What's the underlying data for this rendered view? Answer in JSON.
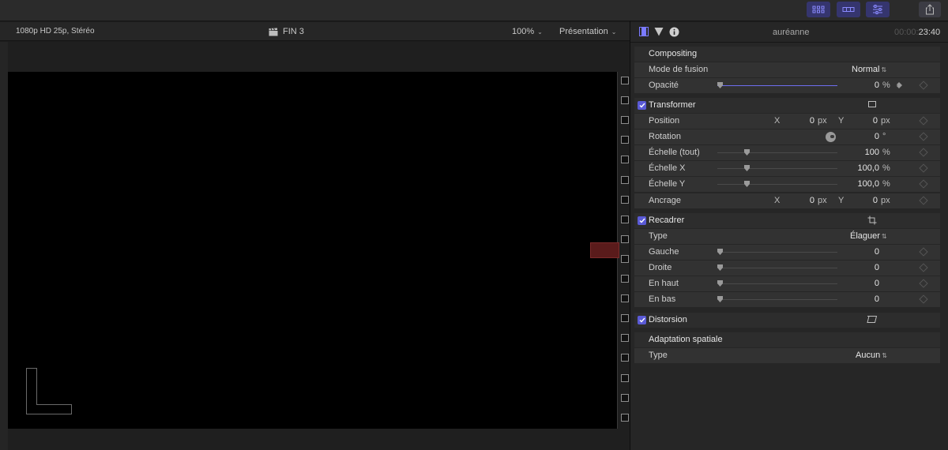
{
  "toolbar": {
    "buttons": [
      {
        "icon": "grid-view-icon",
        "active": true
      },
      {
        "icon": "filmstrip-icon",
        "active": true
      },
      {
        "icon": "inspector-sliders-icon",
        "active": true
      },
      {
        "icon": "share-icon",
        "active": false
      }
    ]
  },
  "viewer": {
    "format": "1080p HD 25p, Stéréo",
    "clip_title": "FIN 3",
    "zoom": "100%",
    "presentation": "Présentation"
  },
  "inspector": {
    "clip_name": "auréanne",
    "timecode_dim": "00:00:",
    "timecode": "23:40",
    "compositing": {
      "title": "Compositing",
      "blend_mode_label": "Mode de fusion",
      "blend_mode_value": "Normal",
      "opacity_label": "Opacité",
      "opacity_value": "0",
      "opacity_unit": "%",
      "opacity_level": 0.0
    },
    "transform": {
      "title": "Transformer",
      "enabled": true,
      "position_label": "Position",
      "position_x": "0",
      "position_y": "0",
      "rotation_label": "Rotation",
      "rotation_value": "0",
      "rotation_unit": "°",
      "scale_all_label": "Échelle (tout)",
      "scale_all_value": "100",
      "scale_x_label": "Échelle X",
      "scale_x_value": "100,0",
      "scale_y_label": "Échelle Y",
      "scale_y_value": "100,0",
      "anchor_label": "Ancrage",
      "anchor_x": "0",
      "anchor_y": "0",
      "x_label": "X",
      "y_label": "Y",
      "px_unit": "px",
      "pct_unit": "%"
    },
    "crop": {
      "title": "Recadrer",
      "enabled": true,
      "type_label": "Type",
      "type_value": "Élaguer",
      "left_label": "Gauche",
      "left_value": "0",
      "right_label": "Droite",
      "right_value": "0",
      "top_label": "En haut",
      "top_value": "0",
      "bottom_label": "En bas",
      "bottom_value": "0"
    },
    "distortion": {
      "title": "Distorsion",
      "enabled": true
    },
    "spatial": {
      "title": "Adaptation spatiale",
      "type_label": "Type",
      "type_value": "Aucun"
    }
  },
  "colors": {
    "accent": "#5a5ad6",
    "slider_fill": "#6e6ef0",
    "toolbar_active": "#35356e"
  }
}
